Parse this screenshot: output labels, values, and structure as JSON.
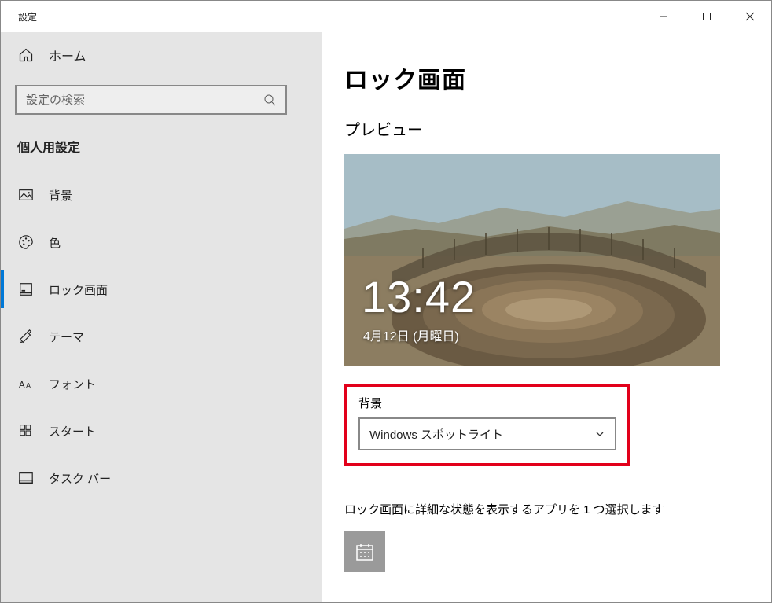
{
  "titlebar": {
    "title": "設定"
  },
  "sidebar": {
    "home_label": "ホーム",
    "search_placeholder": "設定の検索",
    "section_label": "個人用設定",
    "items": [
      {
        "label": "背景",
        "icon": "picture-icon"
      },
      {
        "label": "色",
        "icon": "palette-icon"
      },
      {
        "label": "ロック画面",
        "icon": "lock-screen-icon"
      },
      {
        "label": "テーマ",
        "icon": "theme-icon"
      },
      {
        "label": "フォント",
        "icon": "font-icon"
      },
      {
        "label": "スタート",
        "icon": "start-icon"
      },
      {
        "label": "タスク バー",
        "icon": "taskbar-icon"
      }
    ]
  },
  "content": {
    "page_title": "ロック画面",
    "preview_label": "プレビュー",
    "preview_time": "13:42",
    "preview_date": "4月12日 (月曜日)",
    "background_label": "背景",
    "background_selected": "Windows スポットライト",
    "status_app_instruction": "ロック画面に詳細な状態を表示するアプリを 1 つ選択します"
  }
}
